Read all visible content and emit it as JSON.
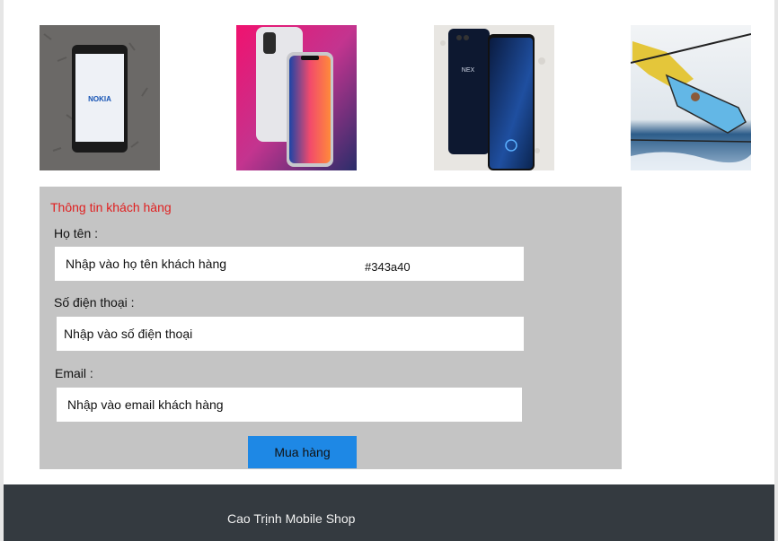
{
  "products": [
    {
      "name": "nokia-phone",
      "brand_text": "NOKIA"
    },
    {
      "name": "iphone-x"
    },
    {
      "name": "vivo-nex",
      "brand_text": "NEX"
    },
    {
      "name": "windsurf"
    }
  ],
  "form": {
    "title": "Thông tin khách hàng",
    "name_label": "Họ tên :",
    "name_placeholder": "Nhập vào họ tên khách hàng",
    "color_note": "#343a40",
    "phone_label": "Số điện thoại :",
    "phone_placeholder": "Nhập vào số điện thoại",
    "email_label": "Email :",
    "email_placeholder": "Nhập vào email khách hàng",
    "submit_label": "Mua hàng"
  },
  "footer": {
    "text": "Cao Trịnh Mobile Shop"
  },
  "colors": {
    "footer_bg": "#343a40",
    "button_bg": "#1e88e5",
    "form_bg": "#c4c4c4",
    "title": "#e02020"
  }
}
